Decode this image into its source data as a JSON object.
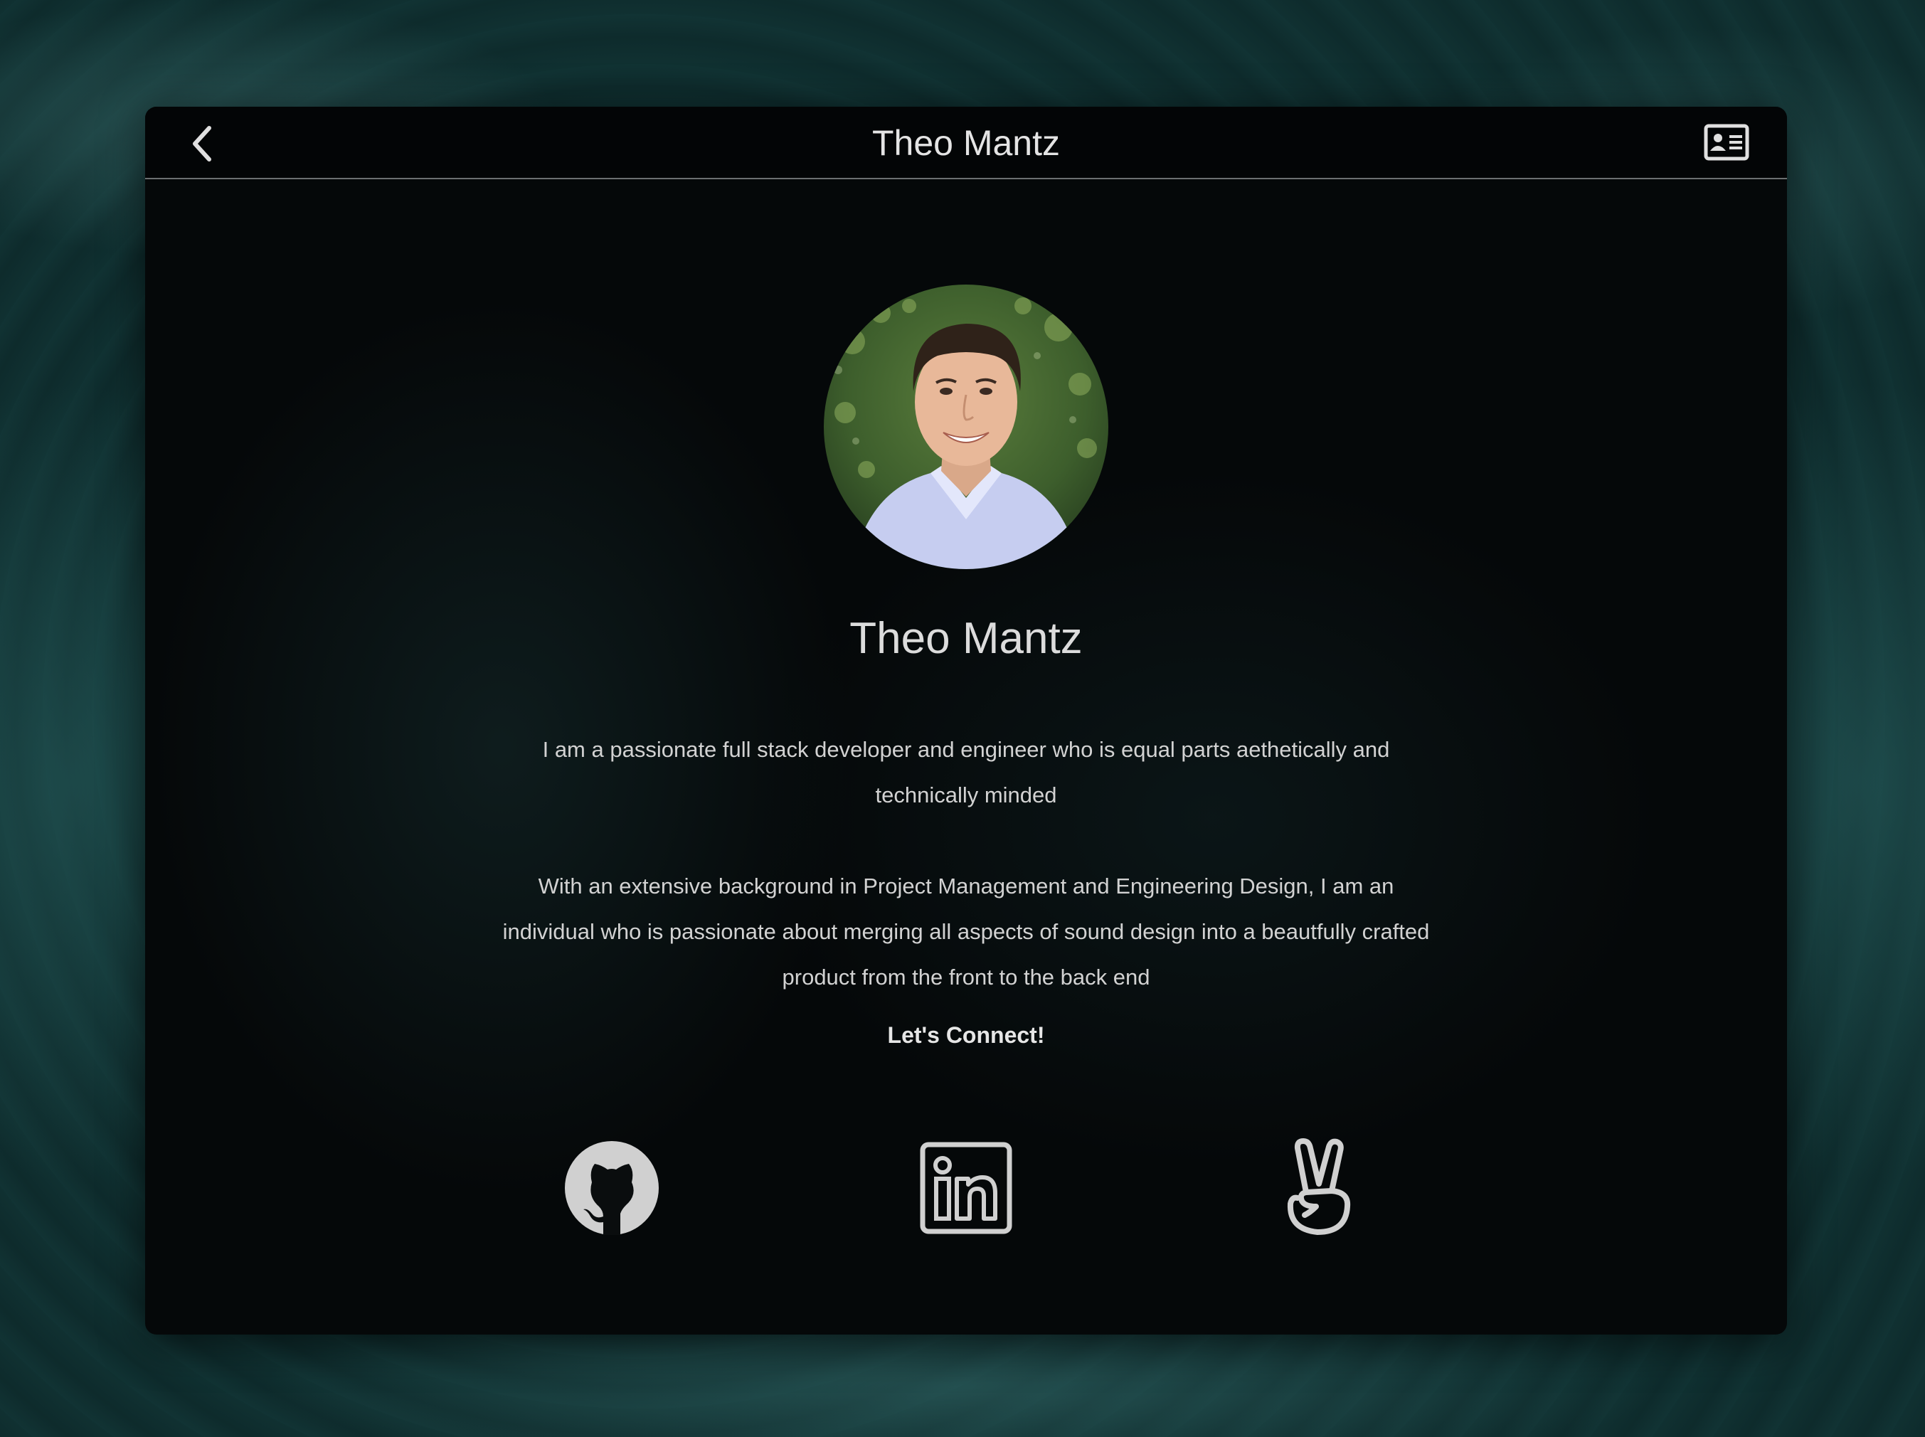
{
  "header": {
    "title": "Theo Mantz",
    "back_icon": "chevron-left-icon",
    "contact_icon": "contact-card-icon"
  },
  "profile": {
    "name": "Theo Mantz",
    "avatar_alt": "profile photo"
  },
  "bio": {
    "paragraph1": "I am a passionate full stack developer and engineer who is equal parts aethetically and technically minded",
    "paragraph2": "With an extensive background in Project Management and Engineering Design, I am an individual who is passionate about merging all aspects of sound design into a beautfully crafted product from the front to the back end"
  },
  "connect": {
    "label": "Let's Connect!",
    "links": [
      {
        "icon": "github-icon"
      },
      {
        "icon": "linkedin-icon"
      },
      {
        "icon": "angellist-icon"
      }
    ]
  },
  "colors": {
    "text": "#dcdcdc",
    "icon": "#d0d0d0",
    "card_bg": "#050809",
    "page_bg": "#0e2b2c",
    "divider": "#6b6f70"
  }
}
